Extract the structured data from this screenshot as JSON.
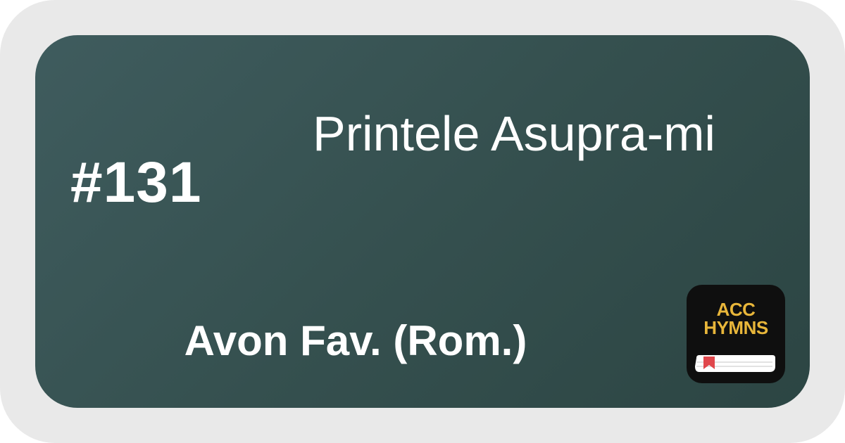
{
  "hymn": {
    "number": "#131",
    "title": "P\u001frintele Asupra-mi",
    "source": "Avon Fav. (Rom.)"
  },
  "app_icon": {
    "line1": "ACC",
    "line2": "HYMNS",
    "icon": "book-icon",
    "colors": {
      "background": "#0f0f0f",
      "text": "#e8b63a",
      "bookmark": "#e0474c"
    }
  },
  "colors": {
    "frame": "#e9e9e9",
    "card_start": "#3f5c5e",
    "card_end": "#2c4543",
    "text": "#ffffff"
  }
}
